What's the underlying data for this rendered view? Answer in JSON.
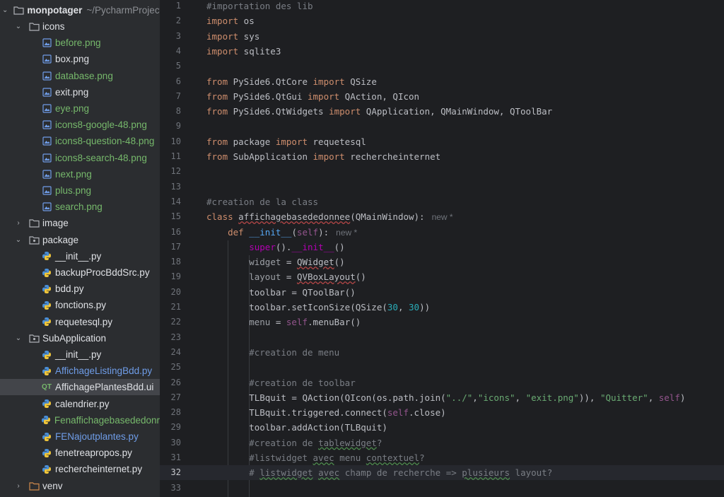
{
  "project": {
    "root_name": "monpotager",
    "root_path": "~/PycharmProject",
    "items": [
      {
        "label": "icons"
      },
      {
        "label": "before.png"
      },
      {
        "label": "box.png"
      },
      {
        "label": "database.png"
      },
      {
        "label": "exit.png"
      },
      {
        "label": "eye.png"
      },
      {
        "label": "icons8-google-48.png"
      },
      {
        "label": "icons8-question-48.png"
      },
      {
        "label": "icons8-search-48.png"
      },
      {
        "label": "next.png"
      },
      {
        "label": "plus.png"
      },
      {
        "label": "search.png"
      },
      {
        "label": "image"
      },
      {
        "label": "package"
      },
      {
        "label": "__init__.py"
      },
      {
        "label": "backupProcBddSrc.py"
      },
      {
        "label": "bdd.py"
      },
      {
        "label": "fonctions.py"
      },
      {
        "label": "requetesql.py"
      },
      {
        "label": "SubApplication"
      },
      {
        "label": "__init__.py"
      },
      {
        "label": "AffichageListingBdd.py"
      },
      {
        "label": "AffichagePlantesBdd.ui"
      },
      {
        "label": "calendrier.py"
      },
      {
        "label": "Fenaffichagebasededonr"
      },
      {
        "label": "FENajoutplantes.py"
      },
      {
        "label": "fenetreapropos.py"
      },
      {
        "label": "rechercheinternet.py"
      },
      {
        "label": "venv"
      }
    ]
  },
  "editor": {
    "current_line": "32",
    "lines": [
      {
        "n": "1",
        "t": [
          {
            "c": "cm",
            "s": "#importation des lib"
          }
        ]
      },
      {
        "n": "2",
        "t": [
          {
            "c": "kw",
            "s": "import"
          },
          {
            "c": "",
            "s": " os"
          }
        ]
      },
      {
        "n": "3",
        "t": [
          {
            "c": "kw",
            "s": "import"
          },
          {
            "c": "",
            "s": " sys"
          }
        ]
      },
      {
        "n": "4",
        "t": [
          {
            "c": "kw",
            "s": "import"
          },
          {
            "c": "",
            "s": " sqlite3"
          }
        ]
      },
      {
        "n": "5",
        "t": []
      },
      {
        "n": "6",
        "t": [
          {
            "c": "kw",
            "s": "from"
          },
          {
            "c": "",
            "s": " PySide6.QtCore "
          },
          {
            "c": "kw",
            "s": "import"
          },
          {
            "c": "",
            "s": " QSize"
          }
        ]
      },
      {
        "n": "7",
        "t": [
          {
            "c": "kw",
            "s": "from"
          },
          {
            "c": "",
            "s": " PySide6.QtGui "
          },
          {
            "c": "kw",
            "s": "import"
          },
          {
            "c": "",
            "s": " QAction, QIcon"
          }
        ]
      },
      {
        "n": "8",
        "t": [
          {
            "c": "kw",
            "s": "from"
          },
          {
            "c": "",
            "s": " PySide6.QtWidgets "
          },
          {
            "c": "kw",
            "s": "import"
          },
          {
            "c": "",
            "s": " QApplication, QMainWindow, QToolBar"
          }
        ]
      },
      {
        "n": "9",
        "t": []
      },
      {
        "n": "10",
        "t": [
          {
            "c": "kw",
            "s": "from"
          },
          {
            "c": "",
            "s": " package "
          },
          {
            "c": "kw",
            "s": "import"
          },
          {
            "c": "",
            "s": " requetesql"
          }
        ]
      },
      {
        "n": "11",
        "t": [
          {
            "c": "kw",
            "s": "from"
          },
          {
            "c": "",
            "s": " SubApplication "
          },
          {
            "c": "kw",
            "s": "import"
          },
          {
            "c": "",
            "s": " rechercheinternet"
          }
        ]
      },
      {
        "n": "12",
        "t": []
      },
      {
        "n": "13",
        "t": []
      },
      {
        "n": "14",
        "t": [
          {
            "c": "cm",
            "s": "#creation de la class"
          }
        ]
      },
      {
        "n": "15",
        "t": [
          {
            "c": "kw",
            "s": "class"
          },
          {
            "c": "",
            "s": " "
          },
          {
            "c": "undl",
            "s": "affichagebasededonnee"
          },
          {
            "c": "",
            "s": "(QMainWindow):"
          },
          {
            "c": "hint",
            "s": "new *"
          }
        ]
      },
      {
        "n": "16",
        "t": [
          {
            "c": "",
            "s": "    "
          },
          {
            "c": "kw",
            "s": "def"
          },
          {
            "c": "",
            "s": " "
          },
          {
            "c": "fn",
            "s": "__init__"
          },
          {
            "c": "",
            "s": "("
          },
          {
            "c": "slf",
            "s": "self"
          },
          {
            "c": "",
            "s": "):"
          },
          {
            "c": "hint",
            "s": "new *"
          }
        ]
      },
      {
        "n": "17",
        "t": [
          {
            "c": "",
            "s": "        "
          },
          {
            "c": "mag",
            "s": "super"
          },
          {
            "c": "",
            "s": "()."
          },
          {
            "c": "dunder",
            "s": "__init__"
          },
          {
            "c": "",
            "s": "()"
          }
        ]
      },
      {
        "n": "18",
        "t": [
          {
            "c": "",
            "s": "        "
          },
          {
            "c": "dim",
            "s": "widget"
          },
          {
            "c": "",
            "s": " = "
          },
          {
            "c": "undl",
            "s": "QWidget"
          },
          {
            "c": "",
            "s": "()"
          }
        ]
      },
      {
        "n": "19",
        "t": [
          {
            "c": "",
            "s": "        "
          },
          {
            "c": "dim",
            "s": "layout"
          },
          {
            "c": "",
            "s": " = "
          },
          {
            "c": "undl",
            "s": "QVBoxLayout"
          },
          {
            "c": "",
            "s": "()"
          }
        ]
      },
      {
        "n": "20",
        "t": [
          {
            "c": "",
            "s": "        toolbar = QToolBar()"
          }
        ]
      },
      {
        "n": "21",
        "t": [
          {
            "c": "",
            "s": "        toolbar.setIconSize(QSize("
          },
          {
            "c": "num",
            "s": "30"
          },
          {
            "c": "",
            "s": ", "
          },
          {
            "c": "num",
            "s": "30"
          },
          {
            "c": "",
            "s": "))"
          }
        ]
      },
      {
        "n": "22",
        "t": [
          {
            "c": "",
            "s": "        "
          },
          {
            "c": "dim",
            "s": "menu"
          },
          {
            "c": "",
            "s": " = "
          },
          {
            "c": "slf",
            "s": "self"
          },
          {
            "c": "",
            "s": ".menuBar()"
          }
        ]
      },
      {
        "n": "23",
        "t": []
      },
      {
        "n": "24",
        "t": [
          {
            "c": "",
            "s": "        "
          },
          {
            "c": "cm",
            "s": "#creation de menu"
          }
        ]
      },
      {
        "n": "25",
        "t": []
      },
      {
        "n": "26",
        "t": [
          {
            "c": "",
            "s": "        "
          },
          {
            "c": "cm",
            "s": "#creation de toolbar"
          }
        ]
      },
      {
        "n": "27",
        "t": [
          {
            "c": "",
            "s": "        TLBquit = QAction(QIcon(os.path.join("
          },
          {
            "c": "str",
            "s": "\"../\""
          },
          {
            "c": "",
            "s": ","
          },
          {
            "c": "str",
            "s": "\"icons\""
          },
          {
            "c": "",
            "s": ", "
          },
          {
            "c": "str",
            "s": "\"exit.png\""
          },
          {
            "c": "",
            "s": ")), "
          },
          {
            "c": "str",
            "s": "\"Quitter\""
          },
          {
            "c": "",
            "s": ", "
          },
          {
            "c": "slf",
            "s": "self"
          },
          {
            "c": "",
            "s": ")"
          }
        ]
      },
      {
        "n": "28",
        "t": [
          {
            "c": "",
            "s": "        TLBquit.triggered.connect("
          },
          {
            "c": "slf",
            "s": "self"
          },
          {
            "c": "",
            "s": ".close)"
          }
        ]
      },
      {
        "n": "29",
        "t": [
          {
            "c": "",
            "s": "        toolbar.addAction(TLBquit)"
          }
        ]
      },
      {
        "n": "30",
        "t": [
          {
            "c": "",
            "s": "        "
          },
          {
            "c": "cm",
            "s": "#creation de "
          },
          {
            "c": "cm cu",
            "s": "tablewidget"
          },
          {
            "c": "cm",
            "s": "?"
          }
        ]
      },
      {
        "n": "31",
        "t": [
          {
            "c": "",
            "s": "        "
          },
          {
            "c": "cm",
            "s": "#listwidget "
          },
          {
            "c": "cm cu",
            "s": "avec"
          },
          {
            "c": "cm",
            "s": " menu "
          },
          {
            "c": "cm cu",
            "s": "contextuel"
          },
          {
            "c": "cm",
            "s": "?"
          }
        ]
      },
      {
        "n": "32",
        "t": [
          {
            "c": "",
            "s": "        "
          },
          {
            "c": "cm",
            "s": "# "
          },
          {
            "c": "cm cu",
            "s": "listwidget"
          },
          {
            "c": "cm",
            "s": " "
          },
          {
            "c": "cm cu",
            "s": "avec"
          },
          {
            "c": "cm",
            "s": " champ de recherche => "
          },
          {
            "c": "cm cu",
            "s": "plusieurs"
          },
          {
            "c": "cm",
            "s": " layout?"
          }
        ]
      },
      {
        "n": "33",
        "t": []
      }
    ]
  }
}
